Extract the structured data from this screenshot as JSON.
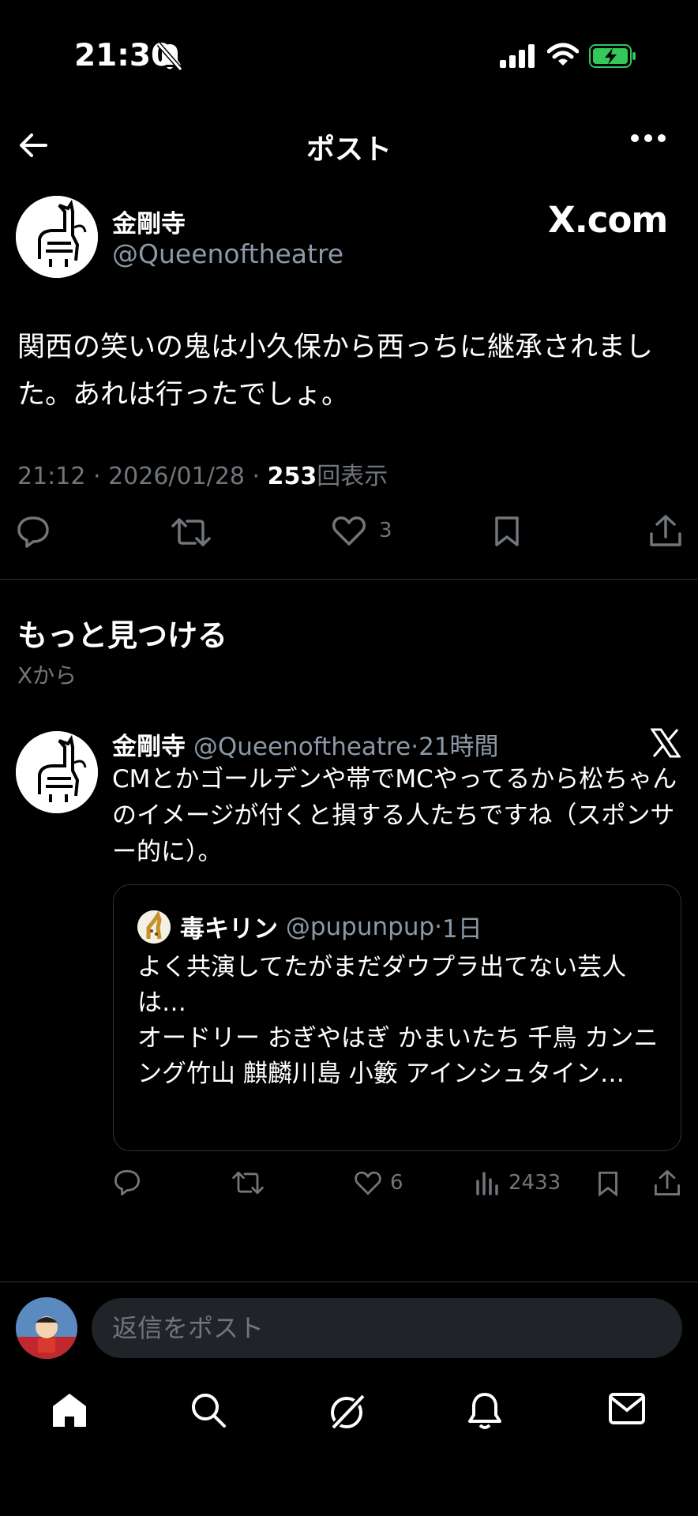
{
  "status_bar": {
    "time": "21:30"
  },
  "header": {
    "title": "ポスト"
  },
  "post": {
    "author_name": "金剛寺",
    "author_handle": "@Queenoftheatre",
    "source_label": "X.com",
    "text": "関西の笑いの鬼は小久保から西っちに継承されました。あれは行ったでしょ。",
    "time": "21:12",
    "date": "2026/01/28",
    "views_count": "253",
    "views_label": "回表示",
    "like_count": "3"
  },
  "discover": {
    "title": "もっと見つける",
    "subtitle": "Xから"
  },
  "recommended_post": {
    "author_name": "金剛寺",
    "author_handle": "@Queenoftheatre",
    "time_ago": "21時間",
    "text": "CMとかゴールデンや帯でMCやってるから松ちゃんのイメージが付くと損する人たちですね（スポンサー的に）。",
    "quote": {
      "author_name": "毒キリン",
      "author_handle": "@pupunpup",
      "time_ago": "1日",
      "text_line1": "よく共演してたがまだダウプラ出てない芸人は…",
      "text_line2": "オードリー おぎやはぎ かまいたち 千鳥 カンニング竹山 麒麟川島 小籔 アインシュタイン…"
    },
    "like_count": "6",
    "view_count": "2433"
  },
  "reply_bar": {
    "placeholder": "返信をポスト"
  },
  "colors": {
    "background": "#000000",
    "text": "#e7e9ea",
    "muted": "#71767b",
    "battery": "#34c759"
  }
}
